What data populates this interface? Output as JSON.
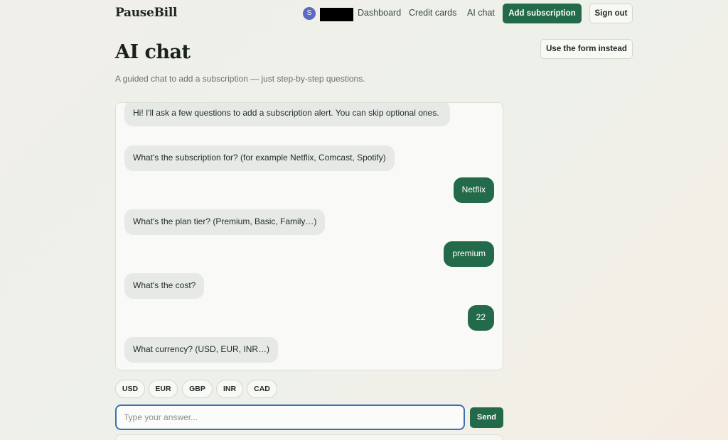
{
  "header": {
    "logo": "PauseBill",
    "avatar_initial": "S",
    "nav": [
      "Dashboard",
      "Credit cards",
      "AI chat"
    ],
    "add_subscription": "Add subscription",
    "sign_out": "Sign out"
  },
  "page": {
    "title": "AI chat",
    "subtitle": "A guided chat to add a subscription — just step-by-step questions.",
    "use_form": "Use the form instead"
  },
  "chat": {
    "messages": [
      {
        "role": "assistant",
        "text": "Hi! I'll ask a few questions to add a subscription alert. You can skip optional ones."
      },
      {
        "role": "assistant",
        "text": "What's the subscription for? (for example Netflix, Comcast, Spotify)"
      },
      {
        "role": "user",
        "text": "Netflix"
      },
      {
        "role": "assistant",
        "text": "What's the plan tier? (Premium, Basic, Family…)"
      },
      {
        "role": "user",
        "text": "premium"
      },
      {
        "role": "assistant",
        "text": "What's the cost?"
      },
      {
        "role": "user",
        "text": "22"
      },
      {
        "role": "assistant",
        "text": "What currency? (USD, EUR, INR…)"
      }
    ]
  },
  "quick_replies": [
    "USD",
    "EUR",
    "GBP",
    "INR",
    "CAD"
  ],
  "composer": {
    "placeholder": "Type your answer...",
    "value": "",
    "send": "Send"
  },
  "colors": {
    "accent": "#226a4a",
    "bot_bubble": "#e6e9e6",
    "input_focus": "#3d6fb8",
    "avatar": "#5b6bbf"
  }
}
